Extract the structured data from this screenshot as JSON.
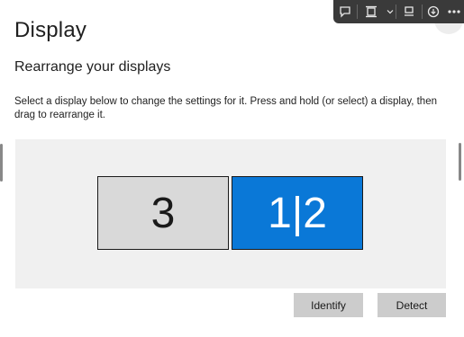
{
  "page": {
    "title": "Display",
    "section_title": "Rearrange your displays",
    "instructions": "Select a display below to change the settings for it. Press and hold (or select) a display, then drag to rearrange it."
  },
  "displays": [
    {
      "label": "3",
      "selected": false,
      "color": "#d9d9d9"
    },
    {
      "label": "1|2",
      "selected": true,
      "color": "#0a78d7"
    }
  ],
  "buttons": {
    "identify": "Identify",
    "detect": "Detect"
  },
  "toolbar": {
    "icons": [
      "comment-icon",
      "fit-page-icon",
      "chevron-down-icon",
      "view-icon",
      "download-icon",
      "more-icon"
    ]
  },
  "colors": {
    "accent": "#0a78d7",
    "area_bg": "#f0f0f0",
    "button_bg": "#cccccc"
  }
}
